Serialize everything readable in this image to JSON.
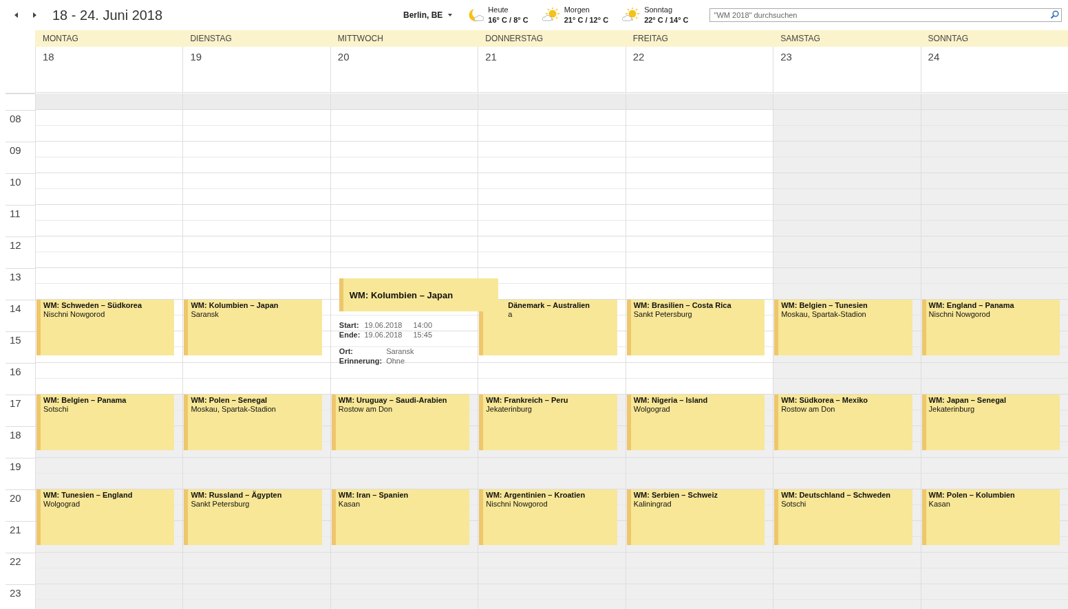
{
  "toolbar": {
    "title": "18 - 24. Juni 2018",
    "location": "Berlin, BE",
    "weather": [
      {
        "kind": "moon",
        "label": "Heute",
        "temps": "16° C / 8° C"
      },
      {
        "kind": "sun",
        "label": "Morgen",
        "temps": "21° C / 12° C"
      },
      {
        "kind": "sun",
        "label": "Sonntag",
        "temps": "22° C / 14° C"
      }
    ],
    "search": {
      "placeholder": "\"WM 2018\" durchsuchen"
    }
  },
  "hours": [
    "08",
    "09",
    "10",
    "11",
    "12",
    "13",
    "14",
    "15",
    "16",
    "17",
    "18",
    "19",
    "20",
    "21",
    "22",
    "23"
  ],
  "days": [
    {
      "name": "MONTAG",
      "date": "18",
      "workday": true,
      "events": [
        {
          "kind": "afternoon",
          "covered": false,
          "title": "WM: Schweden – Südkorea",
          "location": "Nischni Nowgorod"
        },
        {
          "kind": "evening",
          "covered": false,
          "title": "WM: Belgien – Panama",
          "location": "Sotschi"
        },
        {
          "kind": "night",
          "covered": false,
          "title": "WM: Tunesien – England",
          "location": "Wolgograd"
        }
      ]
    },
    {
      "name": "DIENSTAG",
      "date": "19",
      "workday": true,
      "events": [
        {
          "kind": "afternoon",
          "covered": false,
          "title": "WM: Kolumbien – Japan",
          "location": "Saransk"
        },
        {
          "kind": "evening",
          "covered": false,
          "title": "WM: Polen – Senegal",
          "location": "Moskau, Spartak-Stadion"
        },
        {
          "kind": "night",
          "covered": false,
          "title": "WM: Russland – Ägypten",
          "location": "Sankt Petersburg"
        }
      ]
    },
    {
      "name": "MITTWOCH",
      "date": "20",
      "workday": true,
      "events": [
        {
          "kind": "evening",
          "covered": false,
          "title": "WM: Uruguay – Saudi-Arabien",
          "location": "Rostow am Don"
        },
        {
          "kind": "night",
          "covered": false,
          "title": "WM: Iran – Spanien",
          "location": "Kasan"
        }
      ]
    },
    {
      "name": "DONNERSTAG",
      "date": "21",
      "workday": true,
      "events": [
        {
          "kind": "afternoon",
          "covered": true,
          "title": "Dänemark – Australien",
          "location": "a"
        },
        {
          "kind": "evening",
          "covered": false,
          "title": "WM: Frankreich – Peru",
          "location": "Jekaterinburg"
        },
        {
          "kind": "night",
          "covered": false,
          "title": "WM: Argentinien – Kroatien",
          "location": "Nischni Nowgorod"
        }
      ]
    },
    {
      "name": "FREITAG",
      "date": "22",
      "workday": true,
      "events": [
        {
          "kind": "afternoon",
          "covered": false,
          "title": "WM: Brasilien – Costa Rica",
          "location": "Sankt Petersburg"
        },
        {
          "kind": "evening",
          "covered": false,
          "title": "WM: Nigeria – Island",
          "location": "Wolgograd"
        },
        {
          "kind": "night",
          "covered": false,
          "title": "WM: Serbien – Schweiz",
          "location": "Kaliningrad"
        }
      ]
    },
    {
      "name": "SAMSTAG",
      "date": "23",
      "workday": false,
      "events": [
        {
          "kind": "afternoon",
          "covered": false,
          "title": "WM: Belgien – Tunesien",
          "location": "Moskau, Spartak-Stadion"
        },
        {
          "kind": "evening",
          "covered": false,
          "title": "WM: Südkorea – Mexiko",
          "location": "Rostow am Don"
        },
        {
          "kind": "night",
          "covered": false,
          "title": "WM: Deutschland – Schweden",
          "location": "Sotschi"
        }
      ]
    },
    {
      "name": "SONNTAG",
      "date": "24",
      "workday": false,
      "events": [
        {
          "kind": "afternoon",
          "covered": false,
          "title": "WM: England – Panama",
          "location": "Nischni Nowgorod"
        },
        {
          "kind": "evening",
          "covered": false,
          "title": "WM: Japan – Senegal",
          "location": "Jekaterinburg"
        },
        {
          "kind": "night",
          "covered": false,
          "title": "WM: Polen – Kolumbien",
          "location": "Kasan"
        }
      ]
    }
  ],
  "popup": {
    "title": "WM: Kolumbien – Japan",
    "field_groups": [
      [
        {
          "label": "Start:",
          "values": [
            "19.06.2018",
            "14:00"
          ]
        },
        {
          "label": "Ende:",
          "values": [
            "19.06.2018",
            "15:45"
          ]
        }
      ],
      [
        {
          "label": "Ort:",
          "values": [
            "Saransk"
          ]
        },
        {
          "label": "Erinnerung:",
          "values": [
            "Ohne"
          ]
        }
      ]
    ]
  }
}
